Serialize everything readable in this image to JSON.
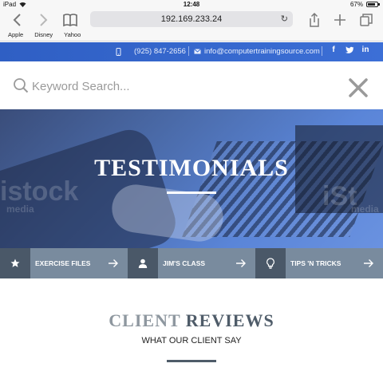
{
  "status_bar": {
    "device": "iPad",
    "time": "12:48",
    "battery": "67%",
    "battery_level": 0.67
  },
  "browser": {
    "url": "192.169.233.24",
    "bookmarks": [
      "Apple",
      "Disney",
      "Yahoo"
    ]
  },
  "contact": {
    "phone": "(925) 847-2656",
    "email": "info@computertrainingsource.com",
    "social": [
      "f",
      "t",
      "in"
    ]
  },
  "search": {
    "placeholder": "Keyword Search..."
  },
  "hero": {
    "title": "TESTIMONIALS",
    "watermarks": [
      "istock",
      "iSt",
      "media",
      "ck"
    ]
  },
  "quick_links": [
    {
      "label": "EXERCISE FILES",
      "icon": "star-icon"
    },
    {
      "label": "JIM'S CLASS",
      "icon": "person-icon"
    },
    {
      "label": "TIPS 'N TRICKS",
      "icon": "lightbulb-icon"
    }
  ],
  "reviews": {
    "title_word1": "CLIENT",
    "title_word2": "REVIEWS",
    "subtitle": "WHAT OUR CLIENT SAY"
  },
  "colors": {
    "contact_bar": "#3c6fd6",
    "quick_links_bg": "#4a5868",
    "quick_links_label": "#798b9e",
    "reviews_dark": "#4f5c69"
  }
}
